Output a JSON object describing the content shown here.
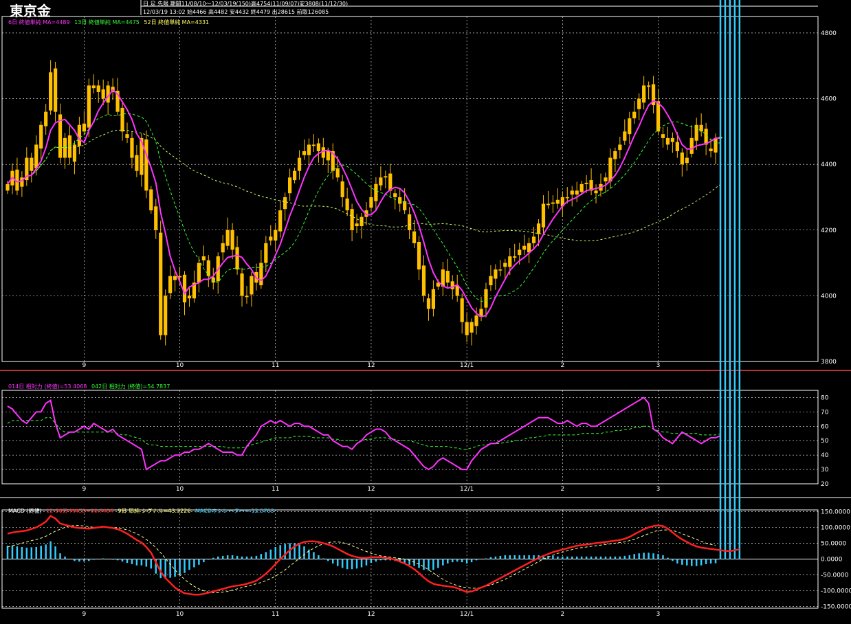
{
  "header": {
    "title": "東京金",
    "info_line1": "日 足 先限 期間11/08/10～12/03/19(150)高4754(11/09/07)安3808(11/12/30)",
    "info_line2": "12/03/19 13:02 始4466 高4482 安4432 終4479 出28615 前取126085"
  },
  "colors": {
    "up": "#FFC000",
    "down": "#FFC000",
    "ma_short": "#FF33FF",
    "ma_mid": "#33FF33",
    "ma_long": "#CCFF66",
    "rsi14": "#FF33FF",
    "rsi42": "#33FF33",
    "macd": "#FF2020",
    "signal": "#FFFF99",
    "osc": "#33CCFF",
    "grid": "#FFFFFF",
    "background": "#000000",
    "border": "#FF4040"
  },
  "chart_data": [
    {
      "type": "candlestick",
      "panel": "price",
      "legend": [
        {
          "label": "6日 終値単純 MA=4489",
          "color": "#FF33FF"
        },
        {
          "label": "13日 終値単純 MA=4475",
          "color": "#33FF33"
        },
        {
          "label": "52日 終値単純 MA=4331",
          "color": "#CCFF66"
        }
      ],
      "ylim": [
        3800,
        4850
      ],
      "yticks": [
        3800,
        4000,
        4200,
        4400,
        4600,
        4800
      ],
      "xticks": [
        {
          "label": "9",
          "index": 16
        },
        {
          "label": "10",
          "index": 36
        },
        {
          "label": "11",
          "index": 56
        },
        {
          "label": "12",
          "index": 76
        },
        {
          "label": "12/1",
          "index": 96
        },
        {
          "label": "2",
          "index": 116
        },
        {
          "label": "3",
          "index": 136
        }
      ],
      "n": 150,
      "close": [
        4340,
        4380,
        4320,
        4360,
        4420,
        4380,
        4460,
        4520,
        4560,
        4680,
        4560,
        4420,
        4480,
        4420,
        4460,
        4520,
        4500,
        4640,
        4640,
        4620,
        4600,
        4640,
        4620,
        4560,
        4500,
        4480,
        4420,
        4380,
        4480,
        4320,
        4260,
        4200,
        3880,
        4000,
        4060,
        4060,
        4060,
        3980,
        4000,
        4040,
        4100,
        4120,
        4060,
        4040,
        4120,
        4160,
        4200,
        4140,
        4080,
        4000,
        4000,
        4060,
        4040,
        4100,
        4160,
        4180,
        4200,
        4260,
        4300,
        4360,
        4380,
        4420,
        4440,
        4460,
        4460,
        4440,
        4420,
        4440,
        4380,
        4360,
        4300,
        4260,
        4200,
        4220,
        4240,
        4260,
        4300,
        4340,
        4360,
        4360,
        4320,
        4300,
        4280,
        4260,
        4200,
        4160,
        4080,
        4000,
        3960,
        4020,
        4040,
        4080,
        4040,
        4020,
        4000,
        3920,
        3880,
        3920,
        3940,
        3960,
        4020,
        4060,
        4080,
        4080,
        4100,
        4120,
        4120,
        4140,
        4140,
        4160,
        4180,
        4220,
        4280,
        4280,
        4280,
        4280,
        4300,
        4300,
        4320,
        4320,
        4340,
        4340,
        4320,
        4320,
        4340,
        4360,
        4420,
        4440,
        4460,
        4500,
        4540,
        4560,
        4600,
        4640,
        4640,
        4580,
        4500,
        4480,
        4460,
        4480,
        4440,
        4400,
        4420,
        4480,
        4520,
        4500,
        4460,
        4440,
        4480,
        4479
      ],
      "open_note": "OHLC generated from close series in script",
      "ma6_last": 4489,
      "ma13_last": 4475,
      "ma52_last": 4331
    },
    {
      "type": "line",
      "panel": "rsi",
      "legend": [
        {
          "label": "014日 相対力 (終値)=53.4068",
          "color": "#FF33FF"
        },
        {
          "label": "042日 相対力 (終値)=54.7837",
          "color": "#33FF33"
        }
      ],
      "ylim": [
        20,
        85
      ],
      "yticks": [
        20,
        30,
        40,
        50,
        60,
        70,
        80
      ],
      "series": [
        {
          "values": [
            74,
            72,
            68,
            64,
            62,
            66,
            70,
            70,
            76,
            78,
            62,
            52,
            54,
            56,
            56,
            58,
            60,
            58,
            62,
            60,
            58,
            56,
            58,
            54,
            52,
            50,
            48,
            46,
            44,
            30,
            32,
            34,
            36,
            36,
            38,
            40,
            40,
            42,
            42,
            44,
            44,
            46,
            48,
            46,
            44,
            42,
            42,
            42,
            40,
            40,
            46,
            50,
            54,
            60,
            62,
            64,
            62,
            64,
            62,
            60,
            62,
            62,
            60,
            60,
            58,
            56,
            54,
            54,
            50,
            48,
            46,
            46,
            44,
            48,
            50,
            54,
            56,
            58,
            58,
            56,
            52,
            50,
            48,
            46,
            44,
            40,
            36,
            32,
            30,
            32,
            36,
            38,
            36,
            34,
            32,
            30,
            30,
            36,
            40,
            44,
            46,
            48,
            48,
            50,
            52,
            54,
            56,
            58,
            60,
            62,
            64,
            66,
            66,
            66,
            64,
            62,
            62,
            64,
            62,
            60,
            62,
            62,
            60,
            60,
            62,
            64,
            66,
            68,
            70,
            72,
            74,
            76,
            78,
            80,
            76,
            58,
            56,
            52,
            50,
            48,
            52,
            56,
            54,
            52,
            50,
            48,
            50,
            52,
            52,
            53.4
          ]
        },
        {
          "values": [
            62,
            64,
            64,
            64,
            64,
            64,
            64,
            64,
            66,
            66,
            62,
            58,
            56,
            56,
            56,
            56,
            56,
            56,
            56,
            56,
            56,
            56,
            56,
            55,
            54,
            54,
            53,
            52,
            51,
            48,
            47,
            47,
            46,
            46,
            46,
            46,
            46,
            46,
            46,
            46,
            46,
            46,
            46,
            46,
            46,
            46,
            45,
            45,
            45,
            45,
            46,
            47,
            48,
            49,
            50,
            51,
            52,
            52,
            52,
            52,
            53,
            53,
            53,
            53,
            52,
            52,
            52,
            52,
            51,
            51,
            50,
            50,
            50,
            50,
            50,
            51,
            51,
            52,
            52,
            52,
            51,
            51,
            50,
            50,
            50,
            49,
            48,
            47,
            46,
            46,
            46,
            46,
            46,
            45,
            45,
            44,
            44,
            45,
            46,
            47,
            47,
            48,
            48,
            48,
            49,
            49,
            50,
            50,
            51,
            52,
            52,
            53,
            53,
            54,
            54,
            54,
            54,
            54,
            54,
            54,
            55,
            55,
            55,
            55,
            55,
            56,
            56,
            57,
            57,
            58,
            58,
            59,
            59,
            60,
            60,
            58,
            57,
            56,
            56,
            55,
            55,
            55,
            55,
            55,
            55,
            54,
            54,
            54,
            54,
            54.8
          ]
        }
      ],
      "xticks": [
        {
          "label": "9",
          "index": 16
        },
        {
          "label": "10",
          "index": 36
        },
        {
          "label": "11",
          "index": 56
        },
        {
          "label": "12",
          "index": 76
        },
        {
          "label": "12/1",
          "index": 96
        },
        {
          "label": "2",
          "index": 116
        },
        {
          "label": "3",
          "index": 136
        }
      ]
    },
    {
      "type": "line",
      "panel": "macd",
      "legend": [
        {
          "label": "MACD (終値)",
          "color": "#FFFFFF"
        },
        {
          "label": "12-26日 MACD=30.7464",
          "color": "#FF2020"
        },
        {
          "label": "9日 単純 シグナル=43.3226",
          "color": "#FFFF99"
        },
        {
          "label": "MACDオシレーター=-12.5763",
          "color": "#33CCFF"
        }
      ],
      "ylim": [
        -155,
        155
      ],
      "yticks": [
        -150,
        -100,
        -50,
        0,
        50,
        100,
        150
      ],
      "ytick_labels": [
        "-150.0000",
        "-100.0000",
        "-50.0000",
        "0.0000",
        "50.0000",
        "100.0000",
        "150.0000"
      ],
      "series": [
        {
          "name": "12-26日 MACD",
          "values": [
            80,
            84,
            86,
            88,
            90,
            95,
            100,
            108,
            118,
            136,
            128,
            112,
            108,
            104,
            100,
            98,
            97,
            96,
            98,
            100,
            102,
            100,
            98,
            94,
            88,
            80,
            70,
            60,
            52,
            38,
            20,
            -10,
            -40,
            -60,
            -75,
            -90,
            -100,
            -108,
            -110,
            -112,
            -112,
            -110,
            -106,
            -102,
            -98,
            -94,
            -90,
            -86,
            -84,
            -82,
            -78,
            -74,
            -68,
            -58,
            -46,
            -32,
            -16,
            0,
            14,
            28,
            40,
            48,
            54,
            56,
            56,
            54,
            50,
            46,
            40,
            32,
            24,
            16,
            10,
            6,
            4,
            4,
            6,
            6,
            6,
            4,
            2,
            -2,
            -8,
            -14,
            -22,
            -32,
            -44,
            -58,
            -70,
            -78,
            -82,
            -84,
            -86,
            -88,
            -92,
            -98,
            -104,
            -102,
            -96,
            -90,
            -84,
            -76,
            -68,
            -60,
            -52,
            -44,
            -36,
            -28,
            -20,
            -12,
            -4,
            4,
            10,
            16,
            22,
            26,
            30,
            34,
            38,
            42,
            44,
            46,
            48,
            50,
            52,
            54,
            56,
            58,
            60,
            64,
            70,
            78,
            86,
            94,
            100,
            104,
            106,
            104,
            96,
            84,
            72,
            62,
            54,
            46,
            40,
            36,
            34,
            32,
            30,
            28,
            26,
            25,
            28,
            30.7
          ]
        },
        {
          "name": "9日 単純 シグナル",
          "values": [
            38,
            42,
            46,
            50,
            54,
            58,
            62,
            66,
            72,
            80,
            88,
            94,
            100,
            104,
            106,
            106,
            104,
            102,
            100,
            100,
            100,
            100,
            100,
            98,
            96,
            92,
            86,
            80,
            72,
            62,
            50,
            36,
            20,
            2,
            -16,
            -34,
            -50,
            -64,
            -76,
            -86,
            -94,
            -100,
            -104,
            -106,
            -106,
            -104,
            -102,
            -98,
            -94,
            -90,
            -86,
            -82,
            -78,
            -74,
            -68,
            -62,
            -54,
            -44,
            -34,
            -22,
            -10,
            2,
            14,
            26,
            34,
            42,
            48,
            52,
            54,
            54,
            52,
            48,
            42,
            36,
            30,
            24,
            18,
            14,
            10,
            8,
            6,
            4,
            2,
            0,
            -4,
            -10,
            -16,
            -24,
            -34,
            -44,
            -54,
            -64,
            -72,
            -78,
            -84,
            -88,
            -90,
            -92,
            -92,
            -90,
            -86,
            -82,
            -76,
            -70,
            -64,
            -56,
            -48,
            -40,
            -32,
            -24,
            -16,
            -8,
            0,
            6,
            12,
            18,
            22,
            26,
            30,
            34,
            36,
            38,
            40,
            42,
            44,
            46,
            48,
            50,
            52,
            54,
            58,
            62,
            68,
            74,
            80,
            86,
            90,
            92,
            92,
            90,
            86,
            80,
            74,
            68,
            62,
            56,
            50,
            46,
            43.3
          ]
        }
      ],
      "oscillator": "macd minus signal, computed in script",
      "xticks": [
        {
          "label": "9",
          "index": 16
        },
        {
          "label": "10",
          "index": 36
        },
        {
          "label": "11",
          "index": 56
        },
        {
          "label": "12",
          "index": 76
        },
        {
          "label": "12/1",
          "index": 96
        },
        {
          "label": "2",
          "index": 116
        },
        {
          "label": "3",
          "index": 136
        }
      ]
    }
  ]
}
